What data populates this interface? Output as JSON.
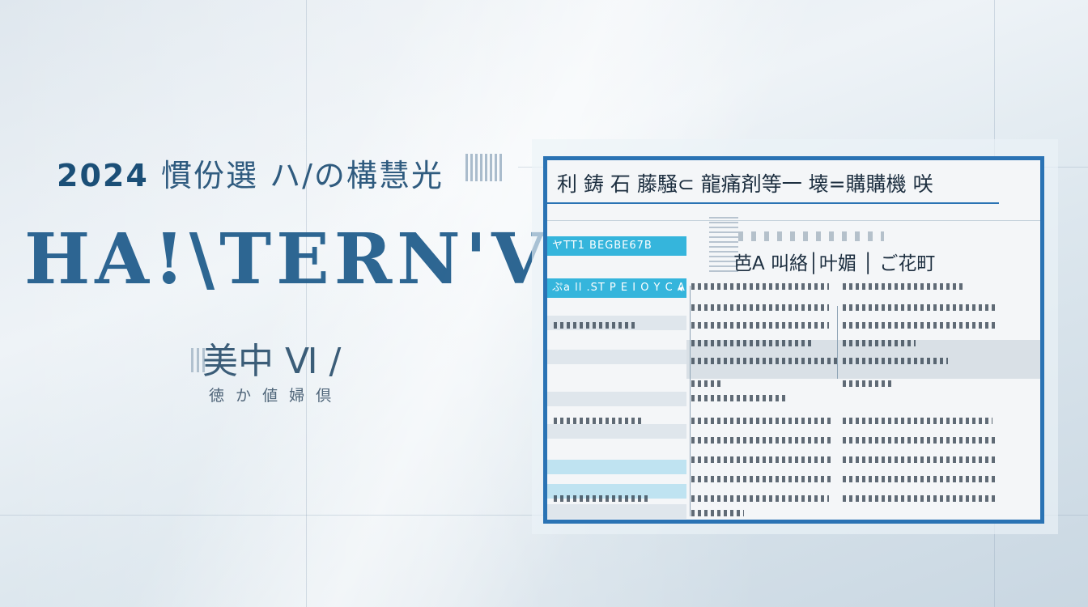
{
  "left": {
    "year": "2024",
    "title_cjk": "慣份選 ハ/の構慧光",
    "big_title": "HA!\\TERN'V",
    "sub_big": "美中 Ⅵ /",
    "sub_small": "徳 か 値 婦 倶"
  },
  "doc": {
    "title": "利 鋳 石 藤騒⊂ 龍痛剤等一 壊=購購機 咲",
    "sidebar": {
      "item1": "ヤTT1 BEGBE67B",
      "item2": "ぷa ll .ST P E I O Y C A",
      "item2_chevron": "◂"
    },
    "headers": "芭A 叫絡│叶媚 │ ご花町"
  },
  "colors": {
    "accent": "#2a73b4",
    "highlight": "#35b5dc",
    "title": "#1d5a8a"
  }
}
